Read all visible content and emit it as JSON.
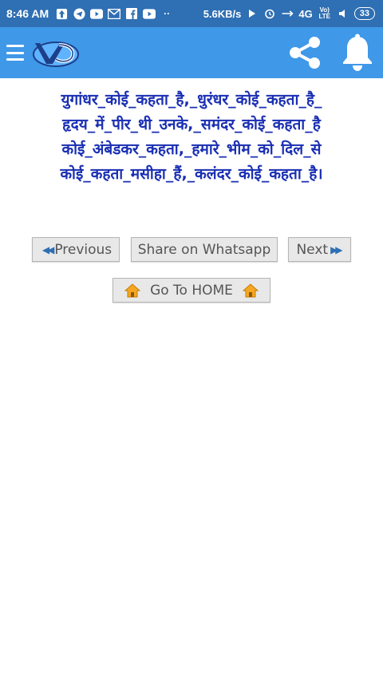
{
  "status_bar": {
    "time": "8:46 AM",
    "net_speed": "5.6KB/s",
    "network": "4G",
    "volte": "Vo) LTE",
    "battery": "33",
    "icons": [
      "upload-icon",
      "telegram-icon",
      "youtube-icon",
      "gmail-icon",
      "facebook-icon",
      "youtube-icon",
      "more-dots-icon",
      "play-icon",
      "alarm-icon",
      "signal-icon",
      "mute-icon"
    ]
  },
  "app_bar": {
    "bg_color": "#3f98e8",
    "icons": [
      "menu-icon",
      "app-logo",
      "share-icon",
      "bell-icon"
    ]
  },
  "content": {
    "text_color": "#1a2fb3",
    "lines": [
      "युगांधर_कोई_कहता_है,_धुरंधर_कोई_कहता_है_",
      "हृदय_में_पीर_थी_उनके,_समंदर_कोई_कहता_है",
      "कोई_अंबेडकर_कहता,_हमारे_भीम_को_दिल_से",
      "कोई_कहता_मसीहा_हैं,_कलंदर_कोई_कहता_है।"
    ]
  },
  "buttons": {
    "previous": "Previous",
    "share": "Share on Whatsapp",
    "next": "Next",
    "home": "Go To HOME"
  }
}
